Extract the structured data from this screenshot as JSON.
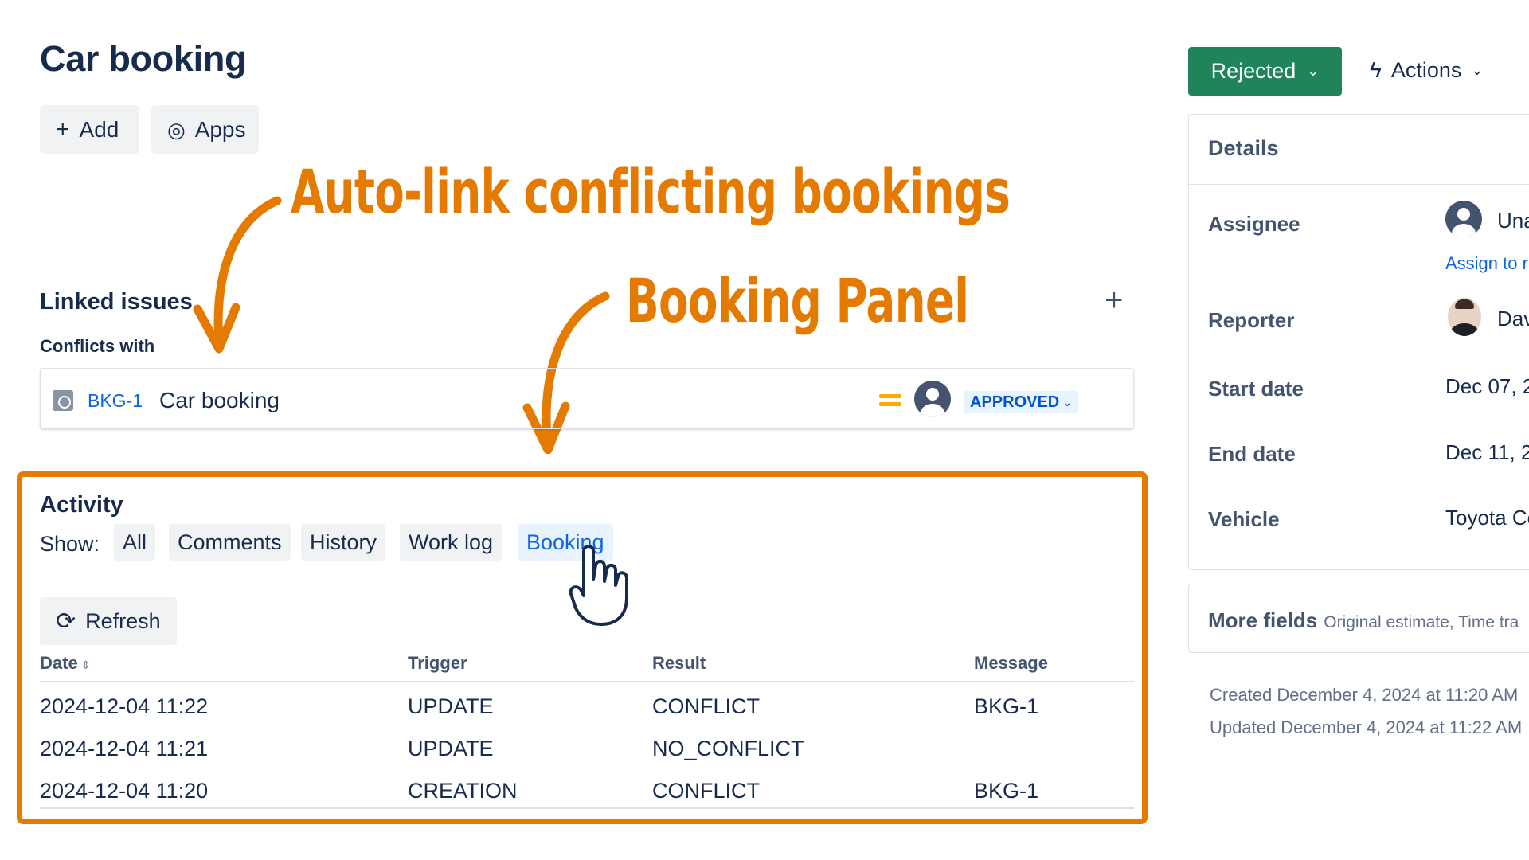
{
  "issue": {
    "title": "Car booking"
  },
  "toolbar": {
    "add_label": "Add",
    "apps_label": "Apps"
  },
  "annotations": {
    "auto_link": "Auto-link conflicting bookings",
    "booking_panel": "Booking Panel"
  },
  "linked_issues": {
    "heading": "Linked issues",
    "relation": "Conflicts with",
    "items": [
      {
        "key": "BKG-1",
        "summary": "Car booking",
        "priority": "Medium",
        "status": "APPROVED"
      }
    ]
  },
  "activity": {
    "heading": "Activity",
    "show_label": "Show:",
    "tabs": [
      {
        "label": "All"
      },
      {
        "label": "Comments"
      },
      {
        "label": "History"
      },
      {
        "label": "Work log"
      },
      {
        "label": "Booking",
        "active": true
      }
    ],
    "refresh_label": "Refresh",
    "columns": [
      "Date",
      "Trigger",
      "Result",
      "Message"
    ],
    "rows": [
      {
        "date": "2024-12-04 11:22",
        "trigger": "UPDATE",
        "result": "CONFLICT",
        "message": "BKG-1"
      },
      {
        "date": "2024-12-04 11:21",
        "trigger": "UPDATE",
        "result": "NO_CONFLICT",
        "message": ""
      },
      {
        "date": "2024-12-04 11:20",
        "trigger": "CREATION",
        "result": "CONFLICT",
        "message": "BKG-1"
      }
    ]
  },
  "status_button": {
    "label": "Rejected",
    "color": "#1f845a"
  },
  "actions_label": "Actions",
  "details": {
    "heading": "Details",
    "assignee_label": "Assignee",
    "assignee_value": "Una",
    "assign_link": "Assign to r",
    "reporter_label": "Reporter",
    "reporter_value": "Dav",
    "start_label": "Start date",
    "start_value": "Dec 07, 2",
    "end_label": "End date",
    "end_value": "Dec 11, 2",
    "vehicle_label": "Vehicle",
    "vehicle_value": "Toyota Co"
  },
  "more_fields": {
    "label": "More fields",
    "hint": "Original estimate, Time tra"
  },
  "meta": {
    "created": "Created December 4, 2024 at 11:20 AM",
    "updated": "Updated December 4, 2024 at 11:22 AM"
  },
  "colors": {
    "accent_orange": "#e57a00",
    "link_blue": "#0c66e4",
    "status_green": "#1f845a"
  }
}
